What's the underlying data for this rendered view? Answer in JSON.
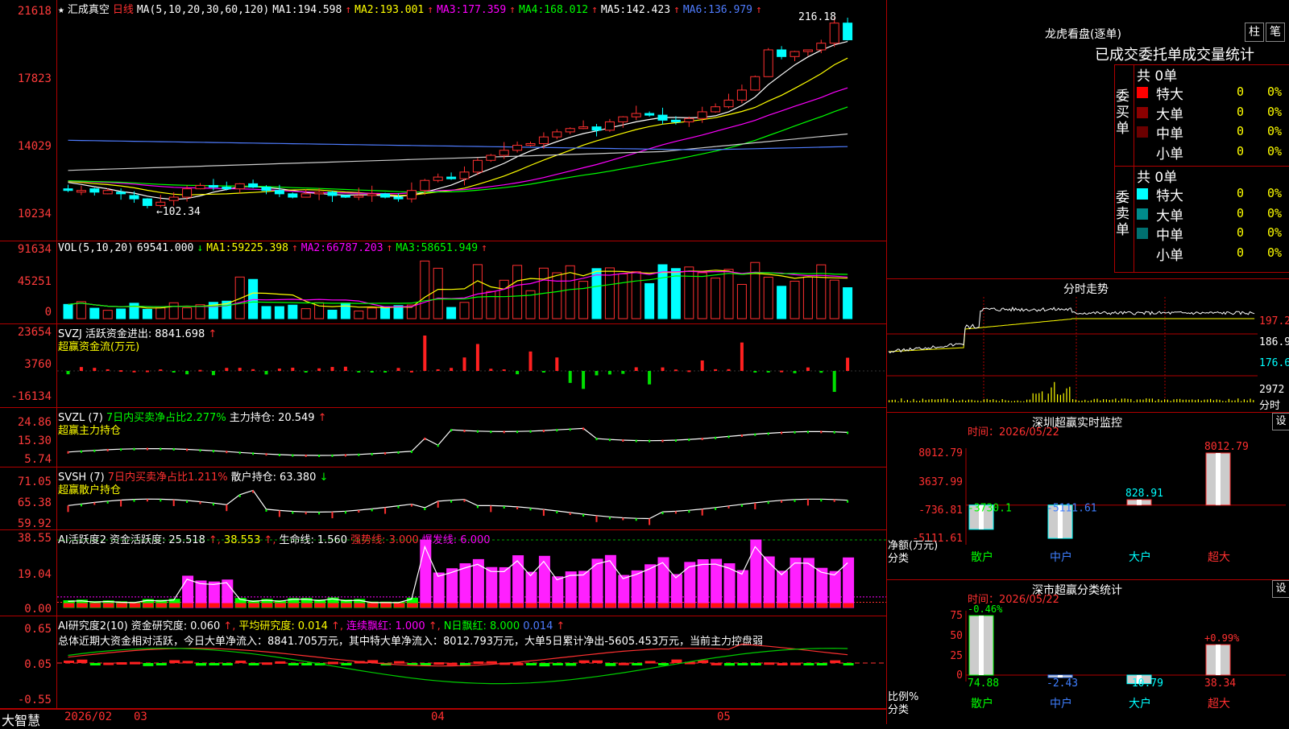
{
  "main": {
    "star": "★",
    "title": "汇成真空",
    "period": "日线",
    "ma_label": "MA(5,10,20,30,60,120)",
    "ma": [
      {
        "name": "MA1:",
        "value": "194.598",
        "arrow": "↑",
        "color": "#ffffff"
      },
      {
        "name": "MA2:",
        "value": "193.001",
        "arrow": "↑",
        "color": "#ffff00"
      },
      {
        "name": "MA3:",
        "value": "177.359",
        "arrow": "↑",
        "color": "#ff00ff"
      },
      {
        "name": "MA4:",
        "value": "168.012",
        "arrow": "↑",
        "color": "#00ff00"
      },
      {
        "name": "MA5:",
        "value": "142.423",
        "arrow": "↑",
        "color": "#ffffff"
      },
      {
        "name": "MA6:",
        "value": "136.979",
        "arrow": "↑",
        "color": "#4f7cff"
      }
    ],
    "ticks": [
      "21618",
      "17823",
      "14029",
      "10234"
    ],
    "high_label": "216.18",
    "low_label": "←102.34"
  },
  "vol": {
    "label": "VOL(5,10,20)",
    "value": "69541.000",
    "arrow": "↓",
    "ma": [
      {
        "name": "MA1:",
        "value": "59225.398",
        "arrow": "↑",
        "color": "#ffff00"
      },
      {
        "name": "MA2:",
        "value": "66787.203",
        "arrow": "↑",
        "color": "#ff00ff"
      },
      {
        "name": "MA3:",
        "value": "58651.949",
        "arrow": "↑",
        "color": "#00ff00"
      }
    ],
    "ticks": [
      "91634",
      "45251",
      "0"
    ]
  },
  "svzj": {
    "label": "SVZJ",
    "desc": "活跃资金进出:",
    "value": "8841.698",
    "arrow": "↑",
    "line2": "超赢资金流(万元)",
    "ticks": [
      "23654",
      "3760",
      "-16134"
    ]
  },
  "svzl": {
    "label": "SVZL (7)",
    "desc": "7日内买卖净占比2.277%",
    "desc2": "主力持仓:",
    "value": "20.549",
    "arrow": "↑",
    "line2": "超赢主力持仓",
    "ticks": [
      "24.86",
      "15.30",
      "5.74"
    ]
  },
  "svsh": {
    "label": "SVSH (7)",
    "desc": "7日内买卖净占比1.211%",
    "desc2": "散户持仓:",
    "value": "63.380",
    "arrow": "↓",
    "line2": "超赢散户持仓",
    "ticks": [
      "71.05",
      "65.38",
      "59.92"
    ]
  },
  "ai2": {
    "label": "AI活跃度2",
    "desc": "资金活跃度:",
    "v1": "25.518",
    "v2": "38.553",
    "v3label": "生命线:",
    "v3": "1.560",
    "v4": "强势线: 3.000",
    "v5": "爆发线: 6.000",
    "ticks": [
      "38.55",
      "19.04",
      "0.00"
    ]
  },
  "ai10": {
    "label": "AI研究度2(10)",
    "desc": "资金研究度:",
    "v1": "0.060",
    "v2label": "平均研究度:",
    "v2": "0.014",
    "v3": "连续飘红: 1.000",
    "v4": "N日飘红: 8.000",
    "v5": "0.014",
    "summary": "总体近期大资金相对活跃，今日大单净流入：8841.705万元，其中特大单净流入：8012.793万元，大单5日累计净出-5605.453万元，当前主力控盘弱",
    "ticks": [
      "0.65",
      "0.05",
      "-0.55"
    ]
  },
  "bottom": {
    "brand": "大智慧",
    "dates": [
      "2026/02",
      "03",
      "04",
      "05"
    ]
  },
  "lhb": {
    "title": "龙虎看盘(逐单)",
    "btn1": "柱",
    "btn2": "笔",
    "subtitle": "已成交委托单成交量统计",
    "buy_label": "委买单",
    "sell_label": "委卖单",
    "buy_total": "共 0单",
    "sell_total": "共 0单",
    "buy_rows": [
      {
        "name": "特大",
        "count": "0",
        "pct": "0%",
        "color": "#ff0000"
      },
      {
        "name": "大单",
        "count": "0",
        "pct": "0%",
        "color": "#8b0000"
      },
      {
        "name": "中单",
        "count": "0",
        "pct": "0%",
        "color": "#6b0000"
      },
      {
        "name": "小单",
        "count": "0",
        "pct": "0%",
        "color": "#000000"
      }
    ],
    "sell_rows": [
      {
        "name": "特大",
        "count": "0",
        "pct": "0%",
        "color": "#00ffff"
      },
      {
        "name": "大单",
        "count": "0",
        "pct": "0%",
        "color": "#008b8b"
      },
      {
        "name": "中单",
        "count": "0",
        "pct": "0%",
        "color": "#007070"
      },
      {
        "name": "小单",
        "count": "0",
        "pct": "0%",
        "color": "#000000"
      }
    ]
  },
  "fenshi": {
    "title": "分时走势",
    "ticks": [
      "197.2",
      "186.9",
      "176.6"
    ],
    "vol_label": "2972",
    "vol_sub": "分时"
  },
  "szjk": {
    "title": "深圳超赢实时监控",
    "btn": "设",
    "time": "时间：2026/05/22",
    "ticks": [
      "8012.79",
      "3637.99",
      "-736.81",
      "-5111.61"
    ],
    "ylabel": "净额(万元)",
    "xlabel": "分类",
    "chart_data": {
      "type": "bar",
      "categories": [
        "散户",
        "中户",
        "大户",
        "超大"
      ],
      "values": [
        -3730.1,
        -5111.61,
        828.91,
        8012.79
      ],
      "value_labels": [
        "-3730.1",
        "-5111.61",
        "828.91",
        "8012.79"
      ],
      "ylim": [
        -5111.61,
        8012.79
      ]
    }
  },
  "szfl": {
    "title": "深市超赢分类统计",
    "btn": "设",
    "time": "时间：2026/05/22",
    "ticks": [
      "75",
      "50",
      "25",
      "0"
    ],
    "ylabel": "比例%",
    "xlabel": "分类",
    "chart_data": {
      "type": "bar",
      "categories": [
        "散户",
        "中户",
        "大户",
        "超大"
      ],
      "values": [
        74.88,
        -2.43,
        -10.79,
        38.34
      ],
      "value_labels": [
        "74.88",
        "-2.43",
        "-10.79",
        "38.34"
      ],
      "changes": [
        "-0.46%",
        "",
        "",
        "+0.99%"
      ],
      "ylim": [
        0,
        75
      ]
    }
  }
}
